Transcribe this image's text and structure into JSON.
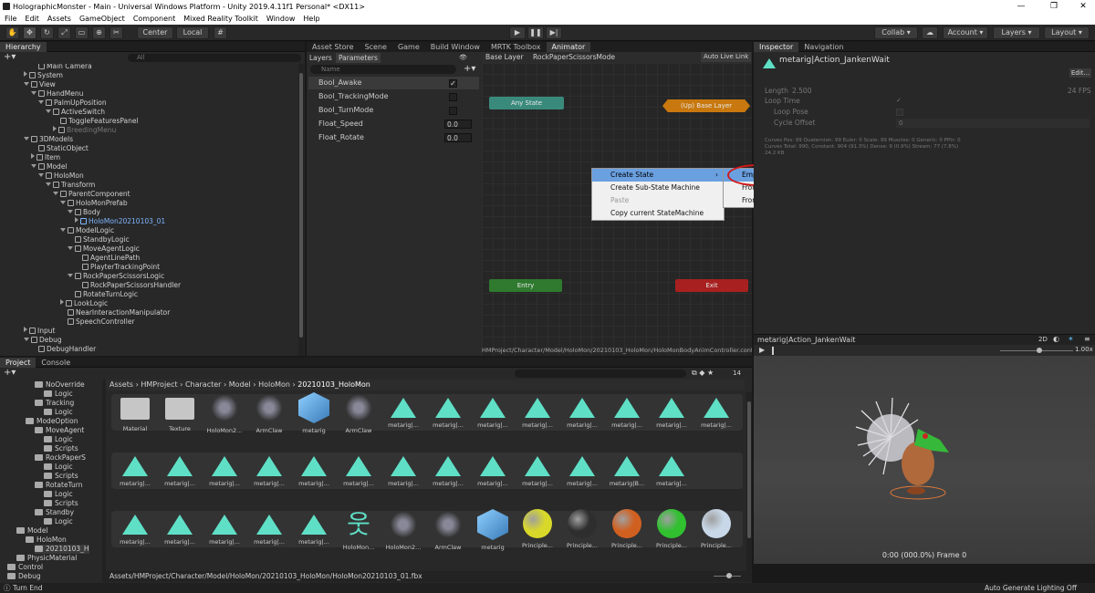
{
  "window": {
    "title": "HolographicMonster - Main - Universal Windows Platform - Unity 2019.4.11f1 Personal* <DX11>"
  },
  "menu": [
    "File",
    "Edit",
    "Assets",
    "GameObject",
    "Component",
    "Mixed Reality Toolkit",
    "Window",
    "Help"
  ],
  "toolbar": {
    "center": "Center",
    "local": "Local",
    "collab": "Collab ▾",
    "account": "Account ▾",
    "layers": "Layers ▾",
    "layout": "Layout ▾"
  },
  "hierarchy": {
    "tab": "Hierarchy",
    "search_placeholder": "All",
    "rows": [
      {
        "label": "Main Camera",
        "depth": 3,
        "tri": ""
      },
      {
        "label": "System",
        "depth": 2,
        "tri": "r"
      },
      {
        "label": "View",
        "depth": 2,
        "tri": "d"
      },
      {
        "label": "HandMenu",
        "depth": 3,
        "tri": "d"
      },
      {
        "label": "PalmUpPosition",
        "depth": 4,
        "tri": "d"
      },
      {
        "label": "ActiveSwitch",
        "depth": 5,
        "tri": "d"
      },
      {
        "label": "ToggleFeaturesPanel",
        "depth": 6,
        "tri": ""
      },
      {
        "label": "BreedingMenu",
        "depth": 6,
        "tri": "r",
        "dim": true
      },
      {
        "label": "3DModels",
        "depth": 2,
        "tri": "d"
      },
      {
        "label": "StaticObject",
        "depth": 3,
        "tri": ""
      },
      {
        "label": "Item",
        "depth": 3,
        "tri": "r"
      },
      {
        "label": "Model",
        "depth": 3,
        "tri": "d"
      },
      {
        "label": "HoloMon",
        "depth": 4,
        "tri": "d"
      },
      {
        "label": "Transform",
        "depth": 5,
        "tri": "d"
      },
      {
        "label": "ParentComponent",
        "depth": 6,
        "tri": "d"
      },
      {
        "label": "HoloMonPrefab",
        "depth": 7,
        "tri": "d"
      },
      {
        "label": "Body",
        "depth": 8,
        "tri": "d"
      },
      {
        "label": "HoloMon20210103_01",
        "depth": 9,
        "tri": "r",
        "blue": true
      },
      {
        "label": "ModelLogic",
        "depth": 7,
        "tri": "d"
      },
      {
        "label": "StandbyLogic",
        "depth": 8,
        "tri": ""
      },
      {
        "label": "MoveAgentLogic",
        "depth": 8,
        "tri": "d"
      },
      {
        "label": "AgentLinePath",
        "depth": 9,
        "tri": ""
      },
      {
        "label": "PlayterTrackingPoint",
        "depth": 9,
        "tri": ""
      },
      {
        "label": "RockPaperScissorsLogic",
        "depth": 8,
        "tri": "d"
      },
      {
        "label": "RockPaperScissorsHandler",
        "depth": 9,
        "tri": ""
      },
      {
        "label": "RotateTurnLogic",
        "depth": 8,
        "tri": ""
      },
      {
        "label": "LookLogic",
        "depth": 7,
        "tri": "r"
      },
      {
        "label": "NearInteractionManipulator",
        "depth": 7,
        "tri": ""
      },
      {
        "label": "SpeechController",
        "depth": 7,
        "tri": ""
      },
      {
        "label": "Input",
        "depth": 2,
        "tri": "r"
      },
      {
        "label": "Debug",
        "depth": 2,
        "tri": "d"
      },
      {
        "label": "DebugHandler",
        "depth": 3,
        "tri": ""
      }
    ]
  },
  "center_tabs": [
    "Asset Store",
    "Scene",
    "Game",
    "Build Window",
    "MRTK Toolbox",
    "Animator"
  ],
  "animator": {
    "sub_tabs": [
      "Layers",
      "Parameters"
    ],
    "search_placeholder": "Name",
    "breadcrumb": [
      "Base Layer",
      "RockPaperScissorsMode"
    ],
    "auto_live": "Auto Live Link",
    "params": [
      {
        "name": "Bool_Awake",
        "type": "bool",
        "value": "✓"
      },
      {
        "name": "Bool_TrackingMode",
        "type": "bool",
        "value": ""
      },
      {
        "name": "Bool_TurnMode",
        "type": "bool",
        "value": ""
      },
      {
        "name": "Float_Speed",
        "type": "float",
        "value": "0.0"
      },
      {
        "name": "Float_Rotate",
        "type": "float",
        "value": "0.0"
      }
    ],
    "nodes": {
      "any": "Any State",
      "up": "(Up) Base Layer",
      "entry": "Entry",
      "exit": "Exit"
    },
    "path": "HMProject/Character/Model/HoloMon/20210103_HoloMon/HoloMonBodyAnimController.controller",
    "context_menu": [
      "Create State",
      "Create Sub-State Machine",
      "Paste",
      "Copy current StateMachine"
    ],
    "submenu": [
      "Empty",
      "From Selected Clip",
      "From New Blend Tree"
    ]
  },
  "inspector": {
    "tabs": [
      "Inspector",
      "Navigation"
    ],
    "title": "metarig|Action_JankenWait",
    "edit": "Edit...",
    "length_label": "Length",
    "length_value": "2.500",
    "fps": "24 FPS",
    "loop_time": "Loop Time",
    "loop_pose": "Loop Pose",
    "cycle_offset": "Cycle Offset",
    "cycle_value": "0",
    "stats1": "Curves Pos: 99 Quaternion: 99 Euler: 0 Scale: 99 Muscles: 0 Generic: 0 PPtr: 0",
    "stats2": "Curves Total: 990, Constant: 904 (91.3%) Dense: 9 (0.9%) Stream: 77 (7.8%)",
    "stats3": "24.2 KB",
    "preview_title": "metarig|Action_JankenWait",
    "preview_2d": "2D",
    "preview_speed": "1.00x",
    "preview_frame": "0:00 (000.0%) Frame 0"
  },
  "project": {
    "tabs": [
      "Project",
      "Console"
    ],
    "count": "14",
    "breadcrumb": [
      "Assets",
      "HMProject",
      "Character",
      "Model",
      "HoloMon",
      "20210103_HoloMon"
    ],
    "folders": [
      {
        "label": "NoOverride",
        "d": 3
      },
      {
        "label": "Logic",
        "d": 4
      },
      {
        "label": "Tracking",
        "d": 3
      },
      {
        "label": "Logic",
        "d": 4
      },
      {
        "label": "ModeOption",
        "d": 2
      },
      {
        "label": "MoveAgent",
        "d": 3
      },
      {
        "label": "Logic",
        "d": 4
      },
      {
        "label": "Scripts",
        "d": 4
      },
      {
        "label": "RockPaperS",
        "d": 3
      },
      {
        "label": "Logic",
        "d": 4
      },
      {
        "label": "Scripts",
        "d": 4
      },
      {
        "label": "RotateTurn",
        "d": 3
      },
      {
        "label": "Logic",
        "d": 4
      },
      {
        "label": "Scripts",
        "d": 4
      },
      {
        "label": "Standby",
        "d": 3
      },
      {
        "label": "Logic",
        "d": 4
      },
      {
        "label": "Model",
        "d": 1
      },
      {
        "label": "HoloMon",
        "d": 2
      },
      {
        "label": "20210103_H",
        "d": 3,
        "sel": true
      },
      {
        "label": "PhysicMaterial",
        "d": 1
      },
      {
        "label": "Control",
        "d": 0
      },
      {
        "label": "Debug",
        "d": 0
      }
    ],
    "row1": [
      "Material",
      "Texture",
      "HoloMon2...",
      "ArmClaw",
      "metarig",
      "ArmClaw",
      "metarig|...",
      "metarig|...",
      "metarig|...",
      "metarig|...",
      "metarig|...",
      "metarig|...",
      "metarig|...",
      "metarig|..."
    ],
    "row2": [
      "metarig|...",
      "metarig|...",
      "metarig|...",
      "metarig|...",
      "metarig|...",
      "metarig|...",
      "metarig|...",
      "metarig|...",
      "metarig|...",
      "metarig|...",
      "metarig|...",
      "metarig|B...",
      "metarig|..."
    ],
    "row3": [
      "metarig|...",
      "metarig|...",
      "metarig|...",
      "metarig|...",
      "metarig|...",
      "HoloMon...",
      "HoloMon2...",
      "ArmClaw",
      "metarig",
      "Principle...",
      "Principle...",
      "Principle...",
      "Principle...",
      "Principle..."
    ],
    "status_path": "Assets/HMProject/Character/Model/HoloMon/20210103_HoloMon/HoloMon20210103_01.fbx"
  },
  "statusbar": {
    "left": "Turn End",
    "right": "Auto Generate Lighting Off"
  },
  "colors": {
    "accent_teal": "#5fe0c6",
    "any_state": "#3a8a7c",
    "up_layer": "#c8780e",
    "entry": "#2f7a2f",
    "exit": "#a82020",
    "highlight": "#6aa0e0",
    "circle": "#d01818"
  }
}
